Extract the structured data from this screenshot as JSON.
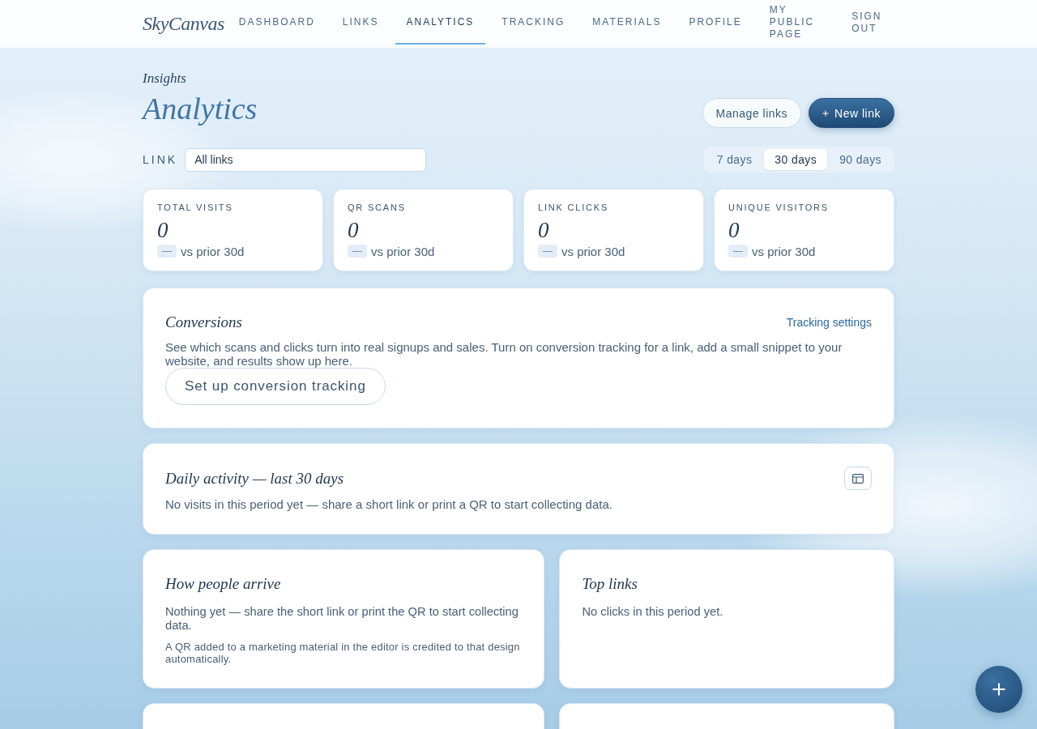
{
  "nav": {
    "logo": "SkyCanvas",
    "items": [
      {
        "label": "DASHBOARD",
        "selected": false
      },
      {
        "label": "LINKS",
        "selected": false
      },
      {
        "label": "ANALYTICS",
        "selected": true
      },
      {
        "label": "TRACKING",
        "selected": false
      },
      {
        "label": "MATERIALS",
        "selected": false
      },
      {
        "label": "PROFILE",
        "selected": false
      },
      {
        "label": "MY PUBLIC PAGE",
        "selected": false
      },
      {
        "label": "SIGN OUT",
        "selected": false
      }
    ]
  },
  "header": {
    "eyebrow": "Insights",
    "title": "Analytics",
    "buttons": [
      {
        "label": "Manage links",
        "kind": "secondary"
      },
      {
        "label": "New link",
        "kind": "primary"
      }
    ]
  },
  "filters": {
    "link_label": "LINK",
    "link_select": {
      "value": "All links"
    },
    "ranges": [
      {
        "label": "7 days",
        "selected": false
      },
      {
        "label": "30 days",
        "selected": true
      },
      {
        "label": "90 days",
        "selected": false
      }
    ]
  },
  "stats": [
    {
      "label": "TOTAL VISITS",
      "value": "0",
      "delta": "—",
      "comparison": "vs prior 30d"
    },
    {
      "label": "QR SCANS",
      "value": "0",
      "delta": "—",
      "comparison": "vs prior 30d"
    },
    {
      "label": "LINK CLICKS",
      "value": "0",
      "delta": "—",
      "comparison": "vs prior 30d"
    },
    {
      "label": "UNIQUE VISITORS",
      "value": "0",
      "delta": "—",
      "comparison": "vs prior 30d"
    }
  ],
  "conversions": {
    "title": "Conversions",
    "link": "Tracking settings",
    "text": "See which scans and clicks turn into real signups and sales. Turn on conversion tracking for a link, add a small snippet to your website, and results show up here.",
    "button": "Set up conversion tracking"
  },
  "daily_activity": {
    "title": "Daily activity — last 30 days",
    "empty_text": "No visits in this period yet — share a short link or print a QR to start collecting data."
  },
  "how_people_arrive": {
    "title": "How people arrive",
    "empty_text": "Nothing yet — share the short link or print the QR to start collecting data.",
    "note": "A QR added to a marketing material in the editor is credited to that design automatically."
  },
  "top_links": {
    "title": "Top links",
    "empty_text": "No clicks in this period yet."
  }
}
